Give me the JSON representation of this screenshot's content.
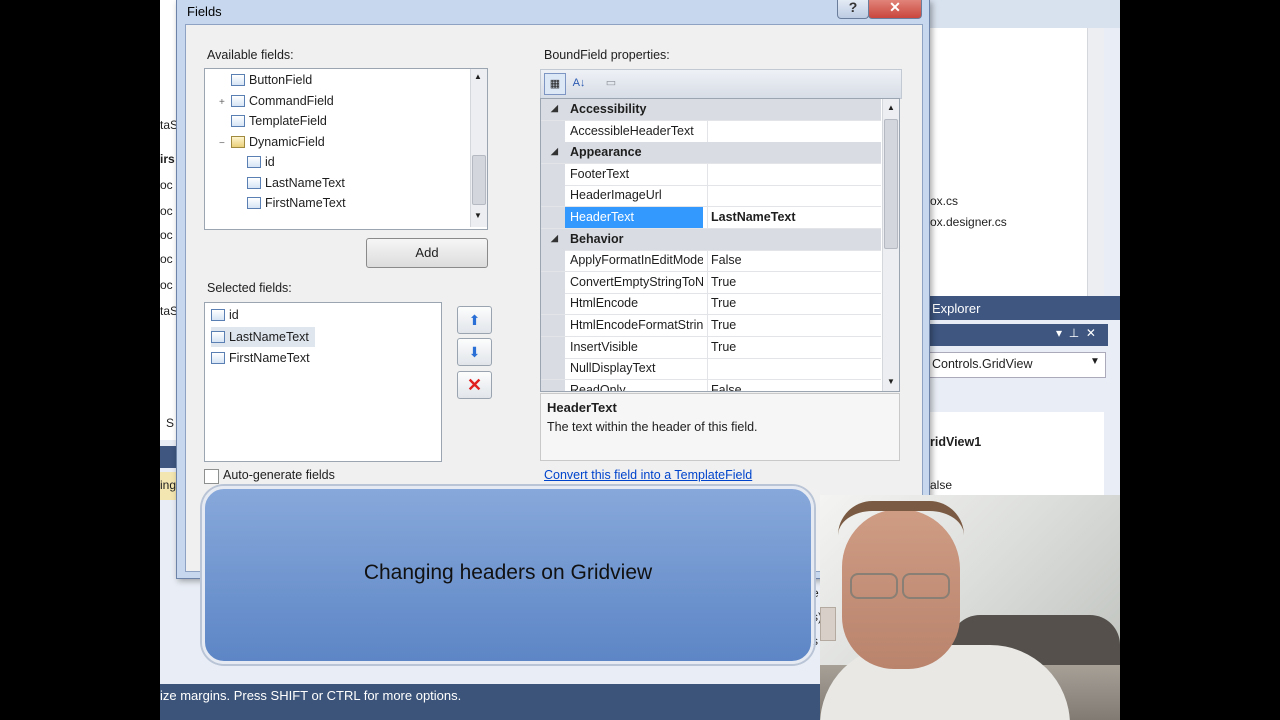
{
  "dialog": {
    "title": "Fields",
    "help_button": "?",
    "close_button": "✕",
    "available_fields_label": "Available fields:",
    "available_fields": [
      {
        "label": "ButtonField",
        "indent": 1,
        "expander": ""
      },
      {
        "label": "CommandField",
        "indent": 1,
        "expander": "+"
      },
      {
        "label": "TemplateField",
        "indent": 1,
        "expander": ""
      },
      {
        "label": "DynamicField",
        "indent": 1,
        "expander": "−"
      },
      {
        "label": "id",
        "indent": 2,
        "expander": ""
      },
      {
        "label": "LastNameText",
        "indent": 2,
        "expander": ""
      },
      {
        "label": "FirstNameText",
        "indent": 2,
        "expander": ""
      }
    ],
    "add_button": "Add",
    "selected_fields_label": "Selected fields:",
    "selected_fields": [
      {
        "label": "id",
        "selected": false
      },
      {
        "label": "LastNameText",
        "selected": true
      },
      {
        "label": "FirstNameText",
        "selected": false
      }
    ],
    "move_up_icon": "arrow-up-icon",
    "move_down_icon": "arrow-down-icon",
    "delete_icon": "red-x-icon",
    "auto_generate_label": "Auto-generate fields",
    "auto_generate_checked": false,
    "properties_label": "BoundField properties:",
    "property_grid": [
      {
        "type": "category",
        "name": "Accessibility"
      },
      {
        "type": "prop",
        "name": "AccessibleHeaderText",
        "value": ""
      },
      {
        "type": "category",
        "name": "Appearance"
      },
      {
        "type": "prop",
        "name": "FooterText",
        "value": ""
      },
      {
        "type": "prop",
        "name": "HeaderImageUrl",
        "value": ""
      },
      {
        "type": "prop",
        "name": "HeaderText",
        "value": "LastNameText",
        "selected": true
      },
      {
        "type": "category",
        "name": "Behavior"
      },
      {
        "type": "prop",
        "name": "ApplyFormatInEditMode",
        "value": "False"
      },
      {
        "type": "prop",
        "name": "ConvertEmptyStringToNull",
        "value": "True"
      },
      {
        "type": "prop",
        "name": "HtmlEncode",
        "value": "True"
      },
      {
        "type": "prop",
        "name": "HtmlEncodeFormatString",
        "value": "True"
      },
      {
        "type": "prop",
        "name": "InsertVisible",
        "value": "True"
      },
      {
        "type": "prop",
        "name": "NullDisplayText",
        "value": ""
      },
      {
        "type": "prop",
        "name": "ReadOnly",
        "value": "False"
      }
    ],
    "description_title": "HeaderText",
    "description_text": "The text within the header of this field.",
    "convert_link": "Convert this field into a TemplateField"
  },
  "ide": {
    "left_fragments": [
      "taS",
      "irs",
      "oc",
      "oc",
      "oc",
      "oc",
      "oc",
      "taS",
      "S",
      "ing"
    ],
    "file_items": [
      "ox.cs",
      "ox.designer.cs"
    ],
    "explorer_title": "Explorer",
    "control_selector": "Controls.GridView",
    "gridview_title": "ridView1",
    "value_false": "alse",
    "right_fragments": [
      "e",
      "s)",
      "s"
    ]
  },
  "overlay": {
    "banner_text": "Changing headers on Gridview"
  },
  "status_bar": {
    "text": "ize margins. Press SHIFT or CTRL for more options."
  },
  "colors": {
    "selection": "#3399ff",
    "link": "#0044cc",
    "banner": "#6f95d0",
    "titlebar_close": "#c9463d"
  }
}
